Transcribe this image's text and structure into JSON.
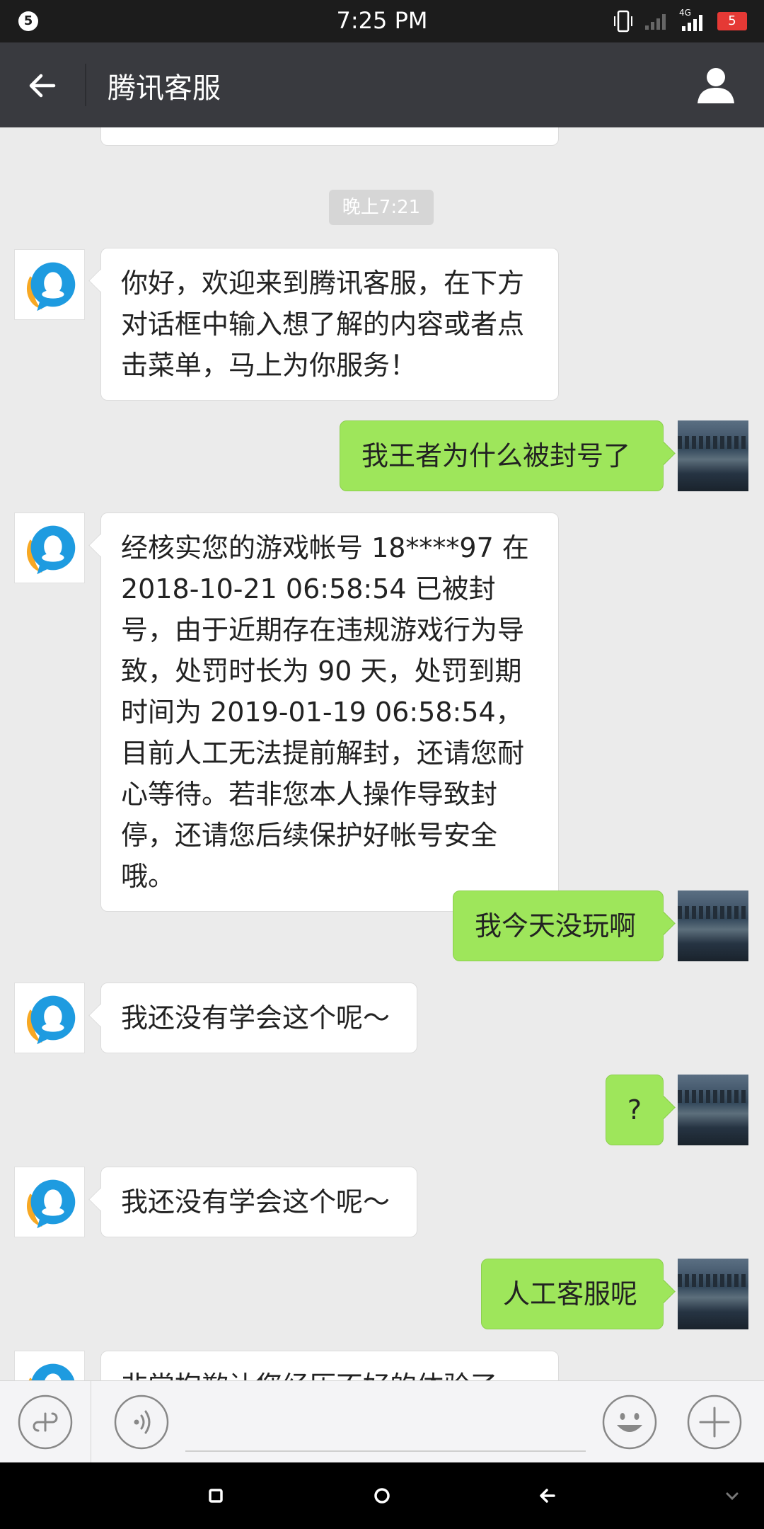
{
  "status_bar": {
    "notification_count": "5",
    "time": "7:25 PM",
    "network": "4G",
    "battery": "5"
  },
  "header": {
    "title": "腾讯客服"
  },
  "chat": {
    "timestamp": "晚上7:21",
    "messages": [
      {
        "from": "service",
        "text": "你好，欢迎来到腾讯客服，在下方对话框中输入想了解的内容或者点击菜单，马上为你服务！"
      },
      {
        "from": "me",
        "text": "我王者为什么被封号了"
      },
      {
        "from": "service",
        "text": "经核实您的游戏帐号 18****97 在 2018-10-21 06:58:54 已被封号，由于近期存在违规游戏行为导致，处罚时长为 90 天，处罚到期时间为 2019-01-19 06:58:54，目前人工无法提前解封，还请您耐心等待。若非您本人操作导致封停，还请您后续保护好帐号安全哦。"
      },
      {
        "from": "me",
        "text": "我今天没玩啊"
      },
      {
        "from": "service",
        "text": "我还没有学会这个呢～"
      },
      {
        "from": "me",
        "text": "?"
      },
      {
        "from": "service",
        "text": "我还没有学会这个呢～"
      },
      {
        "from": "me",
        "text": "人工客服呢"
      },
      {
        "from": "service",
        "text": "非常抱歉让您经历不好的体验了"
      }
    ]
  },
  "colors": {
    "header_bg": "#393a3f",
    "outgoing_bubble": "#9ee65b",
    "chat_bg": "#ebebeb"
  },
  "icons": [
    "back-arrow-icon",
    "person-icon",
    "mini-program-icon",
    "voice-icon",
    "emoji-icon",
    "plus-icon"
  ]
}
